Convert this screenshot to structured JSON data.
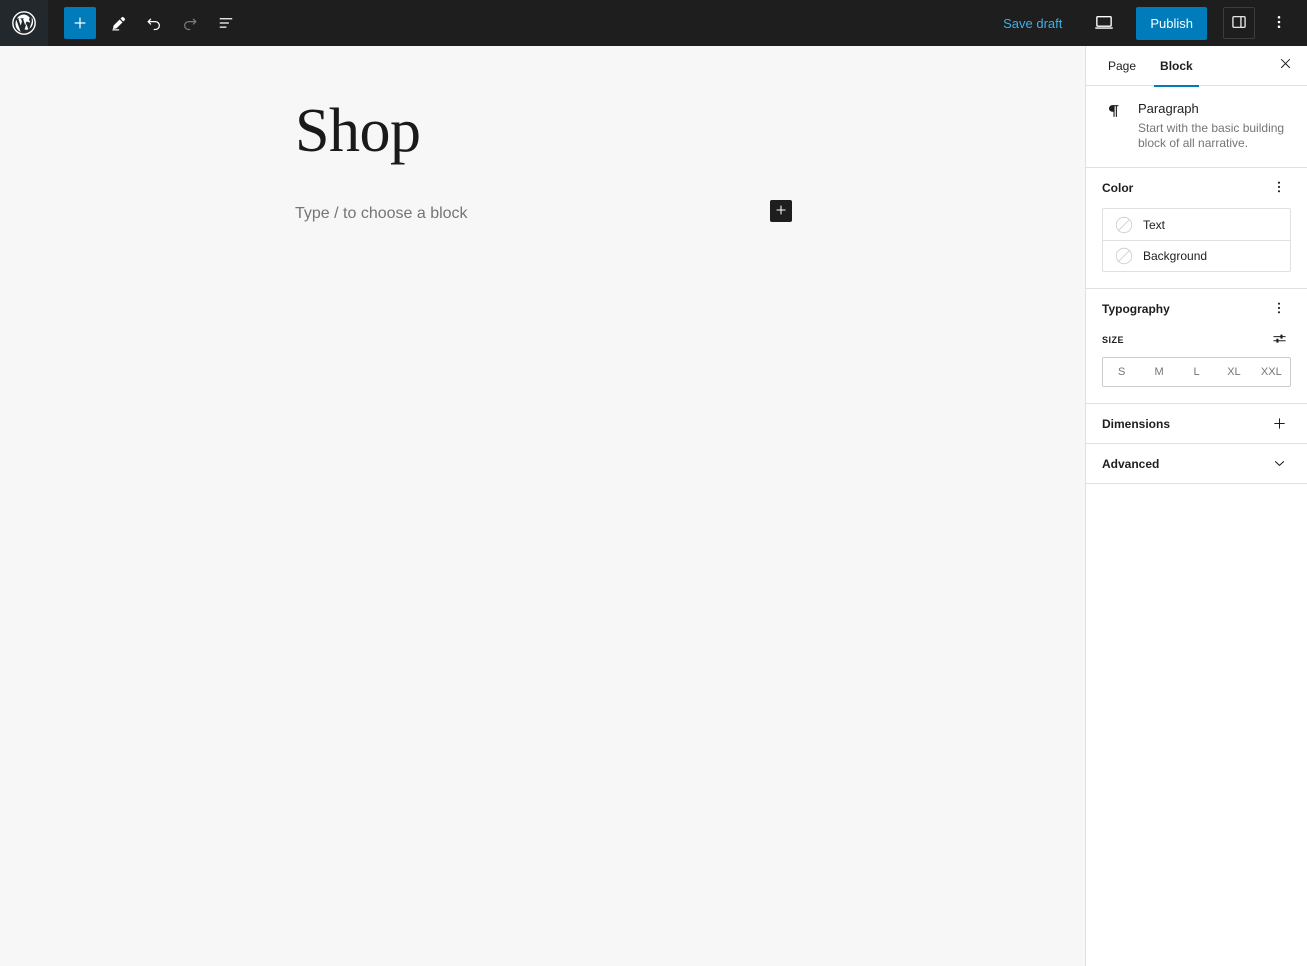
{
  "header": {
    "logo_icon": "wordpress-logo-icon",
    "left_tools": [
      {
        "name": "add-block-button",
        "icon": "plus-icon",
        "label": "Toggle block inserter"
      },
      {
        "name": "tools-button",
        "icon": "pencil-icon",
        "label": "Tools"
      },
      {
        "name": "undo-button",
        "icon": "undo-icon",
        "label": "Undo"
      },
      {
        "name": "redo-button",
        "icon": "redo-icon",
        "label": "Redo"
      },
      {
        "name": "list-view-button",
        "icon": "list-view-icon",
        "label": "Document Overview"
      }
    ],
    "save_draft_label": "Save draft",
    "preview_icon": "desktop-preview-icon",
    "publish_label": "Publish",
    "sidebar_toggle_icon": "sidebar-panel-icon",
    "more_options_icon": "kebab-menu-icon",
    "accent_color": "#007cba",
    "bar_color": "#1e1e1e"
  },
  "canvas": {
    "post_title": "Shop",
    "block_placeholder": "Type / to choose a block",
    "inline_add_icon": "plus-icon",
    "background_color": "#f7f7f7"
  },
  "sidebar": {
    "tabs": [
      {
        "label": "Page",
        "active": false
      },
      {
        "label": "Block",
        "active": true
      }
    ],
    "close_icon": "close-icon",
    "block_card": {
      "icon": "paragraph-pilcrow-icon",
      "title": "Paragraph",
      "description": "Start with the basic building block of all narrative."
    },
    "color_panel": {
      "title": "Color",
      "options_icon": "kebab-menu-icon",
      "items": [
        {
          "label": "Text",
          "swatch": "none-diagonal-swatch"
        },
        {
          "label": "Background",
          "swatch": "none-diagonal-swatch"
        }
      ]
    },
    "typography_panel": {
      "title": "Typography",
      "options_icon": "kebab-menu-icon",
      "size_label": "Size",
      "size_settings_icon": "sliders-icon",
      "size_options": [
        "S",
        "M",
        "L",
        "XL",
        "XXL"
      ]
    },
    "dimensions_panel": {
      "title": "Dimensions",
      "icon": "plus-icon"
    },
    "advanced_panel": {
      "title": "Advanced",
      "icon": "chevron-down-icon"
    }
  }
}
